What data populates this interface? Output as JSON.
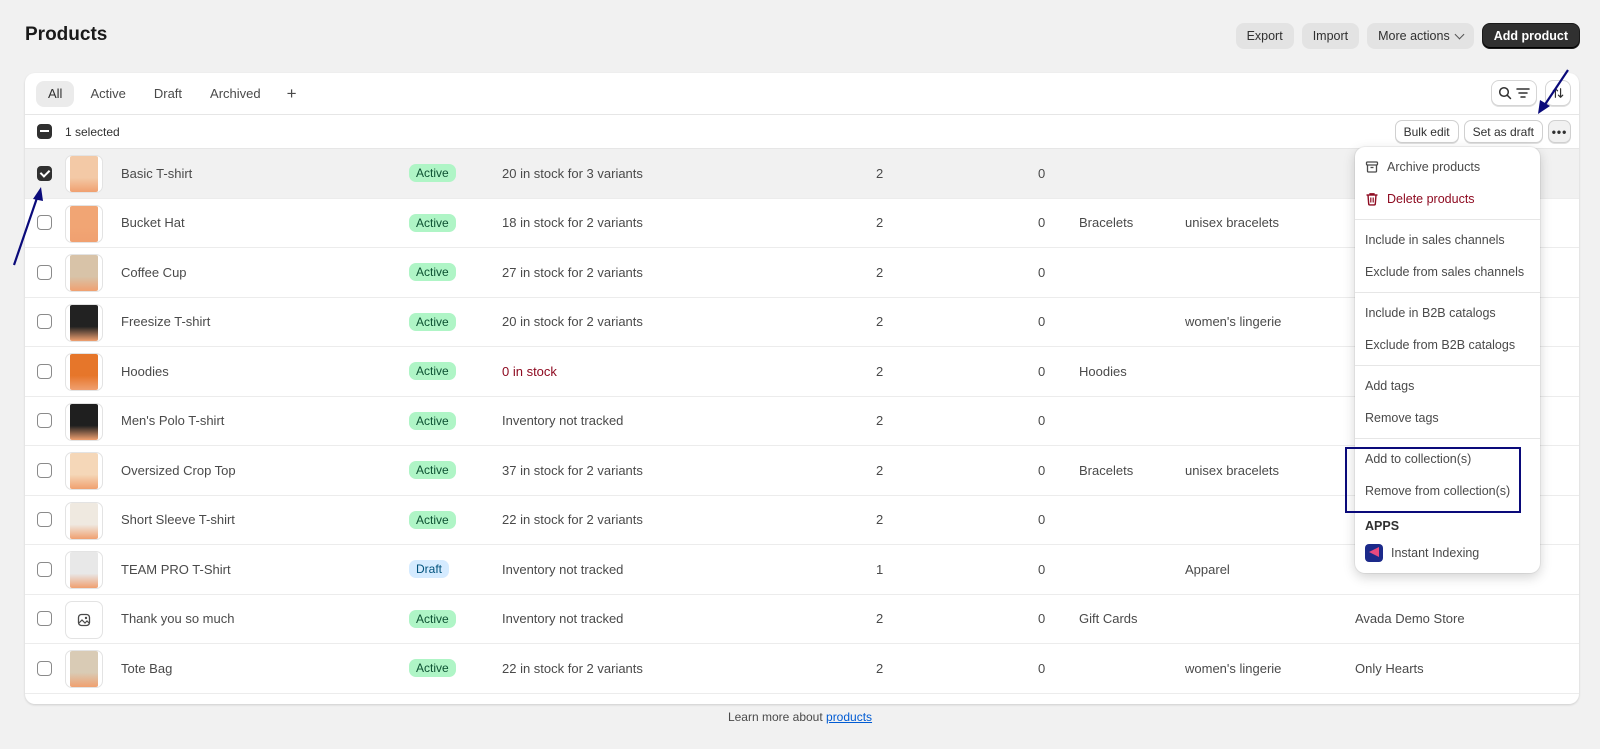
{
  "header": {
    "title": "Products",
    "export_label": "Export",
    "import_label": "Import",
    "more_actions_label": "More actions",
    "add_product_label": "Add product"
  },
  "tabs": [
    {
      "label": "All",
      "active": true
    },
    {
      "label": "Active"
    },
    {
      "label": "Draft"
    },
    {
      "label": "Archived"
    }
  ],
  "tab_add_label": "+",
  "bulk": {
    "selected_text": "1 selected",
    "bulk_edit_label": "Bulk edit",
    "set_draft_label": "Set as draft",
    "more_label": "•••"
  },
  "rows": [
    {
      "name": "Basic T-shirt",
      "status": "Active",
      "inventory": "20 in stock for 3 variants",
      "sales_channels": "2",
      "markets": "0",
      "category": "",
      "type": "",
      "vendor": "",
      "selected": true,
      "thumb": "#f3c9a6"
    },
    {
      "name": "Bucket Hat",
      "status": "Active",
      "inventory": "18 in stock for 2 variants",
      "sales_channels": "2",
      "markets": "0",
      "category": "Bracelets",
      "type": "unisex bracelets",
      "vendor": "",
      "thumb": "#f1a574"
    },
    {
      "name": "Coffee Cup",
      "status": "Active",
      "inventory": "27 in stock for 2 variants",
      "sales_channels": "2",
      "markets": "0",
      "category": "",
      "type": "",
      "vendor": "",
      "thumb": "#d8c3a8"
    },
    {
      "name": "Freesize T-shirt",
      "status": "Active",
      "inventory": "20 in stock for 2 variants",
      "sales_channels": "2",
      "markets": "0",
      "category": "",
      "type": "women's lingerie",
      "vendor": "",
      "thumb": "#222222"
    },
    {
      "name": "Hoodies",
      "status": "Active",
      "inventory": "0 in stock",
      "sales_channels": "2",
      "markets": "0",
      "category": "Hoodies",
      "type": "",
      "vendor": "",
      "inventory_zero": true,
      "thumb": "#e6762a"
    },
    {
      "name": "Men's Polo T-shirt",
      "status": "Active",
      "inventory": "Inventory not tracked",
      "sales_channels": "2",
      "markets": "0",
      "category": "",
      "type": "",
      "vendor": "",
      "thumb": "#1f1f1f"
    },
    {
      "name": "Oversized Crop Top",
      "status": "Active",
      "inventory": "37 in stock for 2 variants",
      "sales_channels": "2",
      "markets": "0",
      "category": "Bracelets",
      "type": "unisex bracelets",
      "vendor": "",
      "thumb": "#f5d7b8"
    },
    {
      "name": "Short Sleeve T-shirt",
      "status": "Active",
      "inventory": "22 in stock for 2 variants",
      "sales_channels": "2",
      "markets": "0",
      "category": "",
      "type": "",
      "vendor": "",
      "thumb": "#efe9e0"
    },
    {
      "name": "TEAM PRO T-Shirt",
      "status": "Draft",
      "inventory": "Inventory not tracked",
      "sales_channels": "1",
      "markets": "0",
      "category": "",
      "type": "Apparel",
      "vendor": "",
      "thumb": "#e8e8e8"
    },
    {
      "name": "Thank you so much",
      "status": "Active",
      "inventory": "Inventory not tracked",
      "sales_channels": "2",
      "markets": "0",
      "category": "Gift Cards",
      "type": "",
      "vendor": "Avada Demo Store",
      "placeholder_thumb": true
    },
    {
      "name": "Tote Bag",
      "status": "Active",
      "inventory": "22 in stock for 2 variants",
      "sales_channels": "2",
      "markets": "0",
      "category": "",
      "type": "women's lingerie",
      "vendor": "Only Hearts",
      "thumb": "#d9cbb5"
    }
  ],
  "menu": {
    "archive": "Archive products",
    "delete": "Delete products",
    "include_sales": "Include in sales channels",
    "exclude_sales": "Exclude from sales channels",
    "include_b2b": "Include in B2B catalogs",
    "exclude_b2b": "Exclude from B2B catalogs",
    "add_tags": "Add tags",
    "remove_tags": "Remove tags",
    "add_collection": "Add to collection(s)",
    "remove_collection": "Remove from collection(s)",
    "apps_heading": "APPS",
    "app_name": "Instant Indexing"
  },
  "footer": {
    "text": "Learn more about ",
    "link": "products"
  },
  "colors": {
    "annotation": "#0a0a7a",
    "active_badge": "#aff5c6",
    "draft_badge": "#d5ebff",
    "danger": "#8e0b21",
    "link": "#005bd3"
  }
}
